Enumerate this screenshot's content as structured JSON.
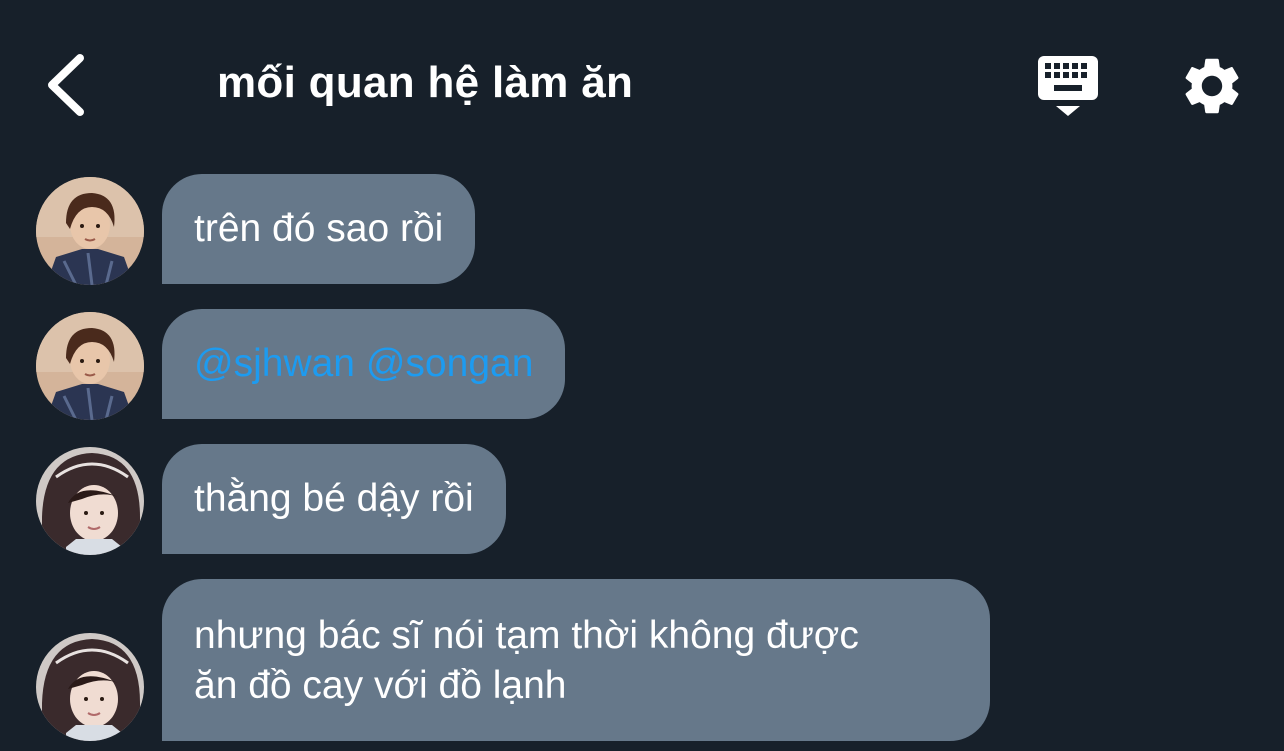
{
  "header": {
    "title": "mối quan hệ làm ăn",
    "back_icon": "chevron-left-icon",
    "keyboard_icon": "keyboard-icon",
    "settings_icon": "gear-icon"
  },
  "colors": {
    "background": "#17202a",
    "bubble": "#66788a",
    "mention": "#1d9bf0",
    "text": "#ffffff"
  },
  "messages": [
    {
      "text": "trên đó sao rồi"
    },
    {
      "mentions": [
        "@sjhwan",
        "@songan"
      ]
    },
    {
      "text": "thằng bé dậy rồi"
    },
    {
      "lines": [
        "nhưng bác sĩ nói tạm thời không được",
        "ăn đồ cay với đồ lạnh"
      ]
    }
  ]
}
